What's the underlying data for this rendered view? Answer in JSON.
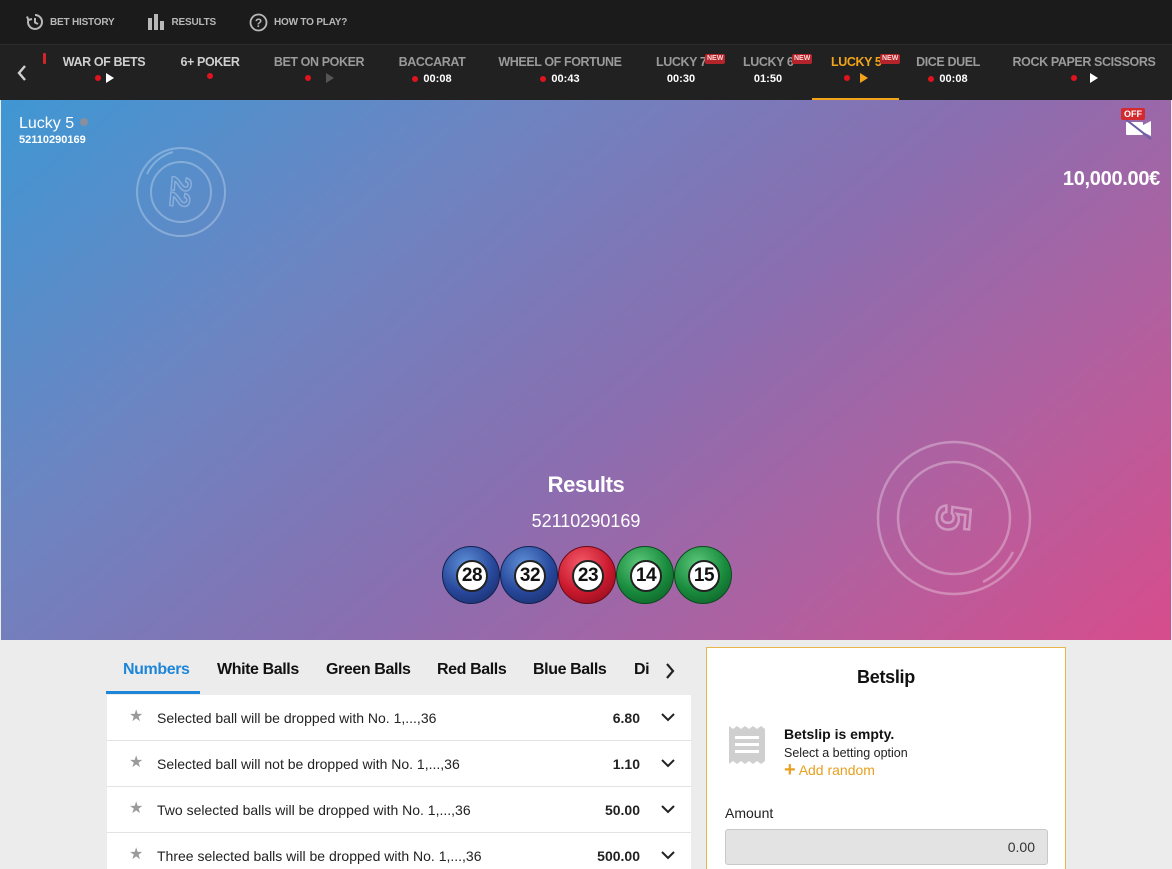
{
  "topbar": {
    "items": [
      {
        "label": "BET HISTORY",
        "icon": "history-icon"
      },
      {
        "label": "RESULTS",
        "icon": "bar-chart-icon"
      },
      {
        "label": "HOW TO PLAY?",
        "icon": "question-circle-icon"
      }
    ]
  },
  "games": [
    {
      "name": "WAR OF BETS",
      "timer": ""
    },
    {
      "name": "6+ POKER",
      "timer": ""
    },
    {
      "name": "BET ON POKER",
      "timer": ""
    },
    {
      "name": "BACCARAT",
      "timer": "00:08"
    },
    {
      "name": "WHEEL OF FORTUNE",
      "timer": "00:43"
    },
    {
      "name": "LUCKY 7",
      "timer": "00:30",
      "badge": "NEW"
    },
    {
      "name": "LUCKY 6",
      "timer": "01:50",
      "badge": "NEW"
    },
    {
      "name": "LUCKY 5",
      "timer": "",
      "badge": "NEW",
      "active": true
    },
    {
      "name": "DICE DUEL",
      "timer": "00:08"
    },
    {
      "name": "ROCK PAPER SCISSORS",
      "timer": ""
    }
  ],
  "stage": {
    "game_title": "Lucky 5",
    "round_id": "52110290169",
    "camera_label": "OFF",
    "balance": "10,000.00€",
    "results_title": "Results",
    "results_id": "52110290169",
    "deco_numbers": [
      "22",
      "5"
    ],
    "balls": [
      {
        "number": "28",
        "color": "blue"
      },
      {
        "number": "32",
        "color": "blue"
      },
      {
        "number": "23",
        "color": "red"
      },
      {
        "number": "14",
        "color": "green"
      },
      {
        "number": "15",
        "color": "green"
      }
    ]
  },
  "tabs": [
    "Numbers",
    "White Balls",
    "Green Balls",
    "Red Balls",
    "Blue Balls",
    "Di"
  ],
  "bets": [
    {
      "label": "Selected ball will be dropped with No. 1,...,36",
      "odds": "6.80"
    },
    {
      "label": "Selected ball will not be dropped with No. 1,...,36",
      "odds": "1.10"
    },
    {
      "label": "Two selected balls will be dropped with No. 1,...,36",
      "odds": "50.00"
    },
    {
      "label": "Three selected balls will be dropped with No. 1,...,36",
      "odds": "500.00"
    }
  ],
  "betslip": {
    "title": "Betslip",
    "empty_title": "Betslip is empty.",
    "empty_hint": "Select a betting option",
    "add_random": "Add random",
    "amount_label": "Amount",
    "amount_value": "0.00"
  },
  "colors": {
    "accent_orange": "#f2a51a",
    "tab_blue": "#1e86d8",
    "live_red": "#e0131f"
  }
}
